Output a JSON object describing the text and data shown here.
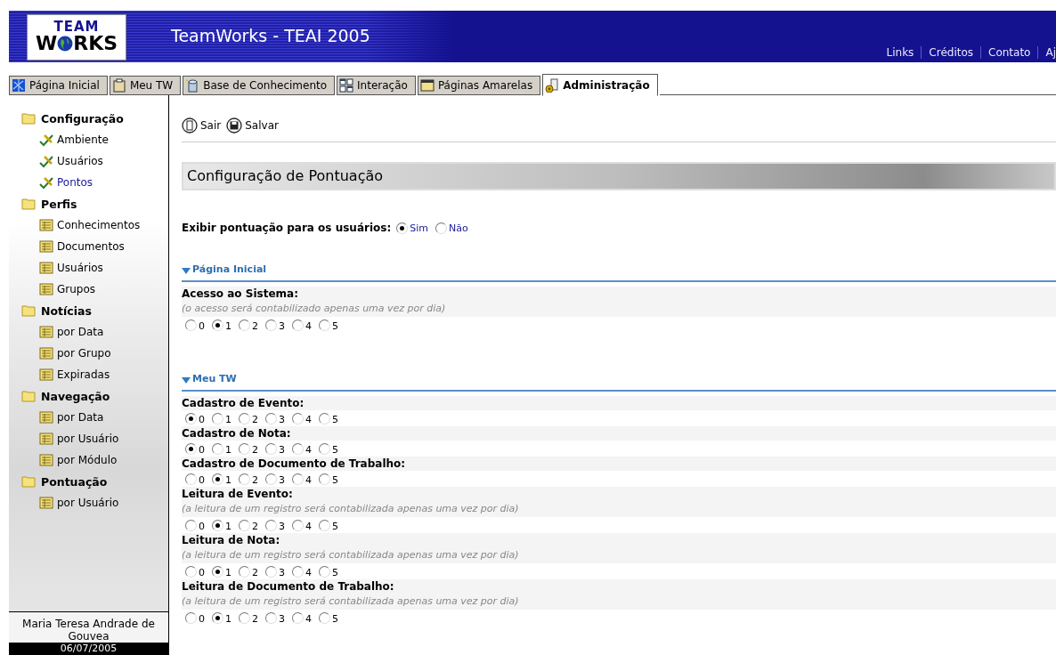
{
  "header": {
    "logo": {
      "top": "TEAM",
      "left": "W",
      "right": "RKS"
    },
    "title": "TeamWorks - TEAI 2005",
    "links": [
      "Links",
      "Créditos",
      "Contato",
      "Aj"
    ]
  },
  "tabs": [
    {
      "label": "Página Inicial",
      "selected": false
    },
    {
      "label": "Meu TW",
      "selected": false
    },
    {
      "label": "Base de Conhecimento",
      "selected": false
    },
    {
      "label": "Interação",
      "selected": false
    },
    {
      "label": "Páginas Amarelas",
      "selected": false
    },
    {
      "label": "Administração",
      "selected": true
    }
  ],
  "sidebar": {
    "items": [
      {
        "label": "Configuração",
        "children": [
          {
            "label": "Ambiente",
            "kind": "setting",
            "selected": false
          },
          {
            "label": "Usuários",
            "kind": "setting",
            "selected": false
          },
          {
            "label": "Pontos",
            "kind": "setting",
            "selected": true
          }
        ]
      },
      {
        "label": "Perfis",
        "children": [
          {
            "label": "Conhecimentos",
            "kind": "report",
            "selected": false
          },
          {
            "label": "Documentos",
            "kind": "report",
            "selected": false
          },
          {
            "label": "Usuários",
            "kind": "report",
            "selected": false
          },
          {
            "label": "Grupos",
            "kind": "report",
            "selected": false
          }
        ]
      },
      {
        "label": "Notícias",
        "children": [
          {
            "label": "por Data",
            "kind": "report",
            "selected": false
          },
          {
            "label": "por Grupo",
            "kind": "report",
            "selected": false
          },
          {
            "label": "Expiradas",
            "kind": "report",
            "selected": false
          }
        ]
      },
      {
        "label": "Navegação",
        "children": [
          {
            "label": "por Data",
            "kind": "report",
            "selected": false
          },
          {
            "label": "por Usuário",
            "kind": "report",
            "selected": false
          },
          {
            "label": "por Módulo",
            "kind": "report",
            "selected": false
          }
        ]
      },
      {
        "label": "Pontuação",
        "children": [
          {
            "label": "por Usuário",
            "kind": "report",
            "selected": false
          }
        ]
      }
    ],
    "user": "Maria Teresa Andrade de Gouvea",
    "date": "06/07/2005"
  },
  "toolbar": [
    {
      "label": "Sair",
      "kind": "exit"
    },
    {
      "label": "Salvar",
      "kind": "save"
    }
  ],
  "page_title": "Configuração de Pontuação",
  "display_setting": {
    "label": "Exibir pontuação para os usuários:",
    "options": [
      {
        "label": "Sim",
        "selected": true
      },
      {
        "label": "Não",
        "selected": false
      }
    ]
  },
  "sections": [
    {
      "title": "Página Inicial",
      "expanded": true,
      "items": [
        {
          "label": "Acesso ao Sistema:",
          "note": "(o acesso será contabilizado apenas uma vez por dia)",
          "options": [
            {
              "label": "0",
              "selected": false
            },
            {
              "label": "1",
              "selected": true
            },
            {
              "label": "2",
              "selected": false
            },
            {
              "label": "3",
              "selected": false
            },
            {
              "label": "4",
              "selected": false
            },
            {
              "label": "5",
              "selected": false
            }
          ]
        }
      ]
    },
    {
      "title": "Meu TW",
      "expanded": true,
      "items": [
        {
          "label": "Cadastro de Evento:",
          "options": [
            {
              "label": "0",
              "selected": true
            },
            {
              "label": "1",
              "selected": false
            },
            {
              "label": "2",
              "selected": false
            },
            {
              "label": "3",
              "selected": false
            },
            {
              "label": "4",
              "selected": false
            },
            {
              "label": "5",
              "selected": false
            }
          ]
        },
        {
          "label": "Cadastro de Nota:",
          "options": [
            {
              "label": "0",
              "selected": true
            },
            {
              "label": "1",
              "selected": false
            },
            {
              "label": "2",
              "selected": false
            },
            {
              "label": "3",
              "selected": false
            },
            {
              "label": "4",
              "selected": false
            },
            {
              "label": "5",
              "selected": false
            }
          ]
        },
        {
          "label": "Cadastro de Documento de Trabalho:",
          "options": [
            {
              "label": "0",
              "selected": false
            },
            {
              "label": "1",
              "selected": true
            },
            {
              "label": "2",
              "selected": false
            },
            {
              "label": "3",
              "selected": false
            },
            {
              "label": "4",
              "selected": false
            },
            {
              "label": "5",
              "selected": false
            }
          ]
        },
        {
          "label": "Leitura de Evento:",
          "note": "(a leitura de um registro será contabilizada apenas uma vez por dia)",
          "options": [
            {
              "label": "0",
              "selected": false
            },
            {
              "label": "1",
              "selected": true
            },
            {
              "label": "2",
              "selected": false
            },
            {
              "label": "3",
              "selected": false
            },
            {
              "label": "4",
              "selected": false
            },
            {
              "label": "5",
              "selected": false
            }
          ]
        },
        {
          "label": "Leitura de Nota:",
          "note": "(a leitura de um registro será contabilizada apenas uma vez por dia)",
          "options": [
            {
              "label": "0",
              "selected": false
            },
            {
              "label": "1",
              "selected": true
            },
            {
              "label": "2",
              "selected": false
            },
            {
              "label": "3",
              "selected": false
            },
            {
              "label": "4",
              "selected": false
            },
            {
              "label": "5",
              "selected": false
            }
          ]
        },
        {
          "label": "Leitura de Documento de Trabalho:",
          "note": "(a leitura de um registro será contabilizada apenas uma vez por dia)",
          "options": [
            {
              "label": "0",
              "selected": false
            },
            {
              "label": "1",
              "selected": true
            },
            {
              "label": "2",
              "selected": false
            },
            {
              "label": "3",
              "selected": false
            },
            {
              "label": "4",
              "selected": false
            },
            {
              "label": "5",
              "selected": false
            }
          ]
        }
      ]
    }
  ]
}
